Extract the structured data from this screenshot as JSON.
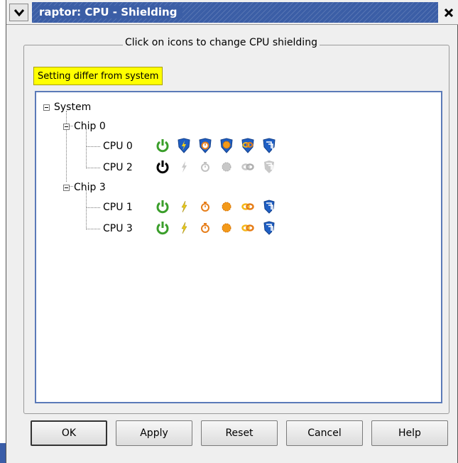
{
  "window": {
    "title": "raptor: CPU - Shielding",
    "menu_icon": "chevron-down-icon",
    "close_icon": "close-x-icon"
  },
  "frame": {
    "legend": "Click on icons to change CPU shielding"
  },
  "status_badge": "Setting differ from system",
  "tree": {
    "root_label": "System",
    "chips": [
      {
        "label": "Chip 0",
        "cpus": [
          {
            "label": "CPU 0",
            "state": "shielded"
          },
          {
            "label": "CPU 2",
            "state": "disabled"
          }
        ]
      },
      {
        "label": "Chip 3",
        "cpus": [
          {
            "label": "CPU 1",
            "state": "unshielded"
          },
          {
            "label": "CPU 3",
            "state": "unshielded"
          }
        ]
      }
    ],
    "icon_columns": [
      "power-icon",
      "lightning-icon",
      "timer-icon",
      "gear-icon",
      "link-icon",
      "fast-forward-icon"
    ]
  },
  "buttons": {
    "ok": "OK",
    "apply": "Apply",
    "reset": "Reset",
    "cancel": "Cancel",
    "help": "Help"
  },
  "colors": {
    "title_bar": "#3b5ea6",
    "power_green": "#3a9e2a",
    "lightning_yellow": "#e8c81a",
    "timer_orange": "#e67e1a",
    "shield_blue": "#1f5fc4",
    "badge_yellow": "#ffff00"
  }
}
